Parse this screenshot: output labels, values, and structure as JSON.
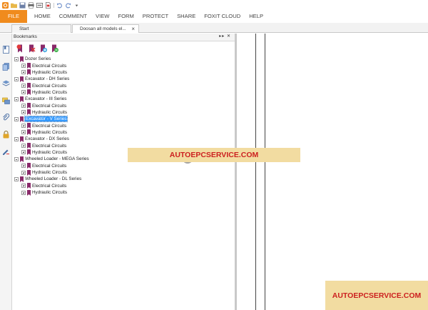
{
  "colors": {
    "file_tab": "#f08b1d",
    "selection": "#3399ff",
    "watermark_bg": "#f2dca1",
    "watermark_text": "#cc1f1f"
  },
  "quick_access": [
    "foxit-logo-icon",
    "open-folder-icon",
    "save-icon",
    "print-icon",
    "scan-icon",
    "new-pdf-icon",
    "undo-icon",
    "redo-icon",
    "customize-icon"
  ],
  "ribbon": {
    "tabs": [
      "FILE",
      "HOME",
      "COMMENT",
      "VIEW",
      "FORM",
      "PROTECT",
      "SHARE",
      "FOXIT CLOUD",
      "HELP"
    ]
  },
  "doc_tabs": [
    {
      "label": "Start"
    },
    {
      "label": "Doosan all models el...",
      "close": "×"
    }
  ],
  "sidebar_icons": [
    "pages-icon",
    "layers-icon",
    "comments-icon",
    "attachments-icon",
    "link-icon",
    "lock-icon",
    "signature-icon"
  ],
  "bookmarks": {
    "title": "Bookmarks",
    "header_buttons": "▸▸ ✕",
    "tools": [
      "new-bookmark-icon",
      "delete-bookmark-icon",
      "add-child-bookmark-icon",
      "expand-bookmark-icon"
    ],
    "tree": [
      {
        "label": "Dozer Series",
        "children": [
          "Electrical Circuits",
          "Hydraulic Circuits"
        ]
      },
      {
        "label": "Excavator - DH Series",
        "children": [
          "Electrical Circuits",
          "Hydraulic Circuits"
        ]
      },
      {
        "label": "Excavator - III Series",
        "children": [
          "Electrical Circuits",
          "Hydraulic Circuits"
        ]
      },
      {
        "label": "Excavator - V Series",
        "selected": true,
        "children": [
          "Electrical Circuits",
          "Hydraulic Circuits"
        ]
      },
      {
        "label": "Excavator - DX Series",
        "children": [
          "Electrical Circuits",
          "Hydraulic Circuits"
        ]
      },
      {
        "label": "Wheeled Loader - MEGA Series",
        "children": [
          "Electrical Circuits",
          "Hydraulic Circuits"
        ]
      },
      {
        "label": "Wheeled Loader - DL Series",
        "children": [
          "Electrical Circuits",
          "Hydraulic Circuits"
        ]
      }
    ]
  },
  "watermarks": [
    "AUTOEPCSERVICE.COM",
    "AUTOEPCSERVICE.COM"
  ]
}
